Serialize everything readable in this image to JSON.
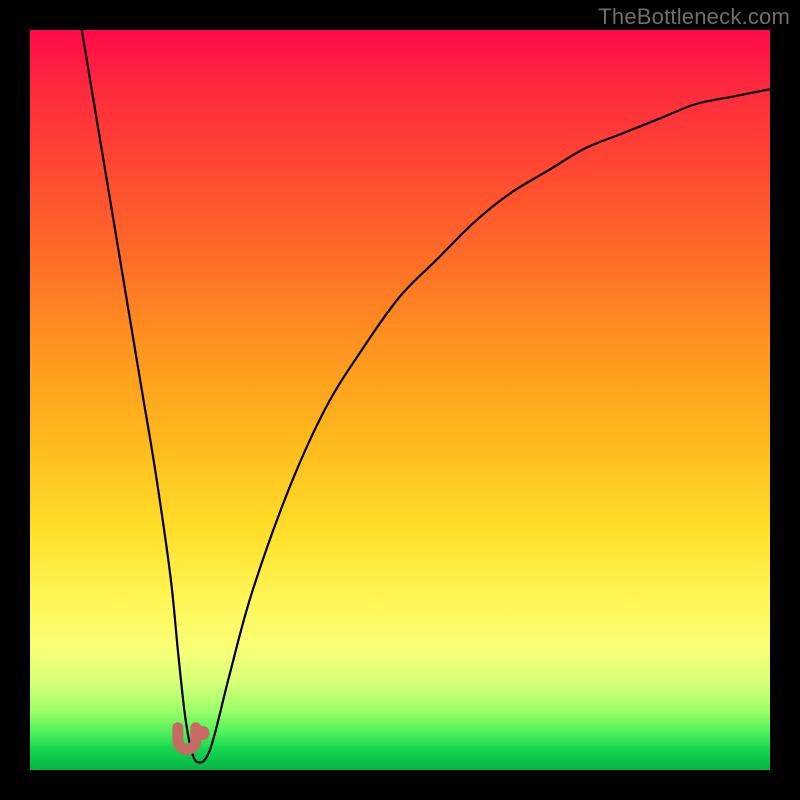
{
  "watermark": "TheBottleneck.com",
  "chart_data": {
    "type": "line",
    "title": "",
    "xlabel": "",
    "ylabel": "",
    "xlim": [
      0,
      100
    ],
    "ylim": [
      0,
      100
    ],
    "grid": false,
    "legend": false,
    "series": [
      {
        "name": "bottleneck-curve",
        "x": [
          7,
          9,
          11,
          13,
          15,
          17,
          19,
          20,
          21,
          22,
          23,
          24,
          25,
          27,
          30,
          35,
          40,
          45,
          50,
          55,
          60,
          65,
          70,
          75,
          80,
          85,
          90,
          95,
          100
        ],
        "y": [
          100,
          88,
          76,
          64,
          52,
          40,
          26,
          16,
          7,
          2,
          1,
          2,
          5,
          13,
          24,
          38,
          49,
          57,
          64,
          69,
          74,
          78,
          81,
          84,
          86,
          88,
          90,
          91,
          92
        ]
      }
    ],
    "markers": [
      {
        "name": "left-nub",
        "x": 21.2,
        "y": 4,
        "color": "#c76a63",
        "display": "u"
      },
      {
        "name": "right-nub",
        "x": 23.3,
        "y": 5,
        "color": "#c76a63",
        "display": "dot"
      }
    ],
    "background_gradient_stops": [
      {
        "pos": 0,
        "color": "#ff0a4a"
      },
      {
        "pos": 50,
        "color": "#ffb81c"
      },
      {
        "pos": 80,
        "color": "#fff85c"
      },
      {
        "pos": 100,
        "color": "#08b446"
      }
    ]
  }
}
